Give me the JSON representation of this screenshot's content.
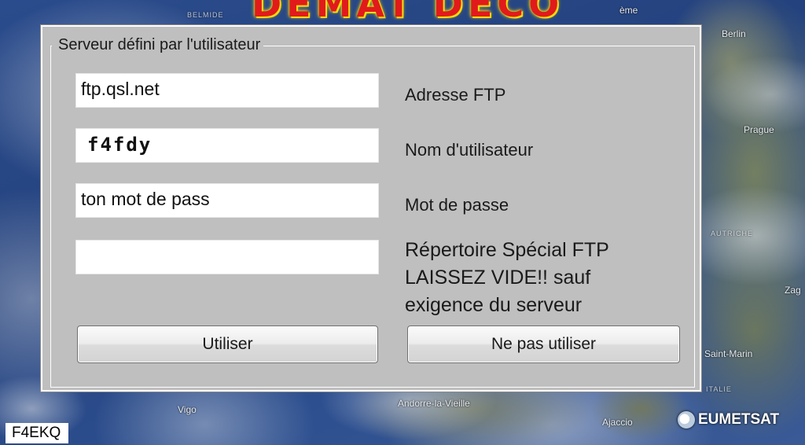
{
  "banner": {
    "text": "DEMAT DECO"
  },
  "map_labels": {
    "top_left": "BELMIDE",
    "top_center": "ème",
    "berlin": "Berlin",
    "prague": "Prague",
    "austria": "AUTRICHE",
    "zag": "Zag",
    "saint_marin": "Saint-Marin",
    "italie": "ITALIE",
    "vigo": "Vigo",
    "andorre": "Andorre-la-Vieille",
    "ajaccio": "Ajaccio"
  },
  "eumetsat": "EUMETSAT",
  "callsign": "F4EKQ",
  "dialog": {
    "group_title": "Serveur défini par l'utilisateur",
    "fields": {
      "ftp_address": {
        "value": "ftp.qsl.net",
        "label": "Adresse FTP"
      },
      "username": {
        "value": "f4fdy",
        "label": "Nom d'utilisateur"
      },
      "password": {
        "value": "ton mot de pass",
        "label": "Mot de passe"
      },
      "directory": {
        "value": "",
        "note": "Répertoire Spécial FTP LAISSEZ VIDE!! sauf exigence du serveur"
      }
    },
    "buttons": {
      "use": "Utiliser",
      "dont_use": "Ne pas utiliser"
    }
  },
  "colors": {
    "dialog_bg": "#bfbfbf",
    "banner_red": "#e11b1b",
    "banner_yellow": "#f6e20a"
  }
}
